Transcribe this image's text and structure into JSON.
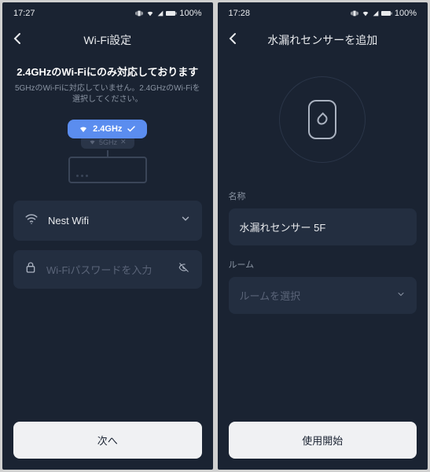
{
  "left": {
    "status": {
      "time": "17:27",
      "battery": "100%"
    },
    "title": "Wi-Fi設定",
    "headline": "2.4GHzのWi-Fiにのみ対応しております",
    "sub": "5GHzのWi-Fiに対応していません。2.4GHzのWi-Fiを選択してください。",
    "pill24": "2.4GHz",
    "pill5": "5GHz",
    "ssid": "Nest Wifi",
    "pwdPlaceholder": "Wi-Fiパスワードを入力",
    "next": "次へ"
  },
  "right": {
    "status": {
      "time": "17:28",
      "battery": "100%"
    },
    "title": "水漏れセンサーを追加",
    "nameLabel": "名称",
    "nameValue": "水漏れセンサー 5F",
    "roomLabel": "ルーム",
    "roomPlaceholder": "ルームを選択",
    "start": "使用開始"
  }
}
